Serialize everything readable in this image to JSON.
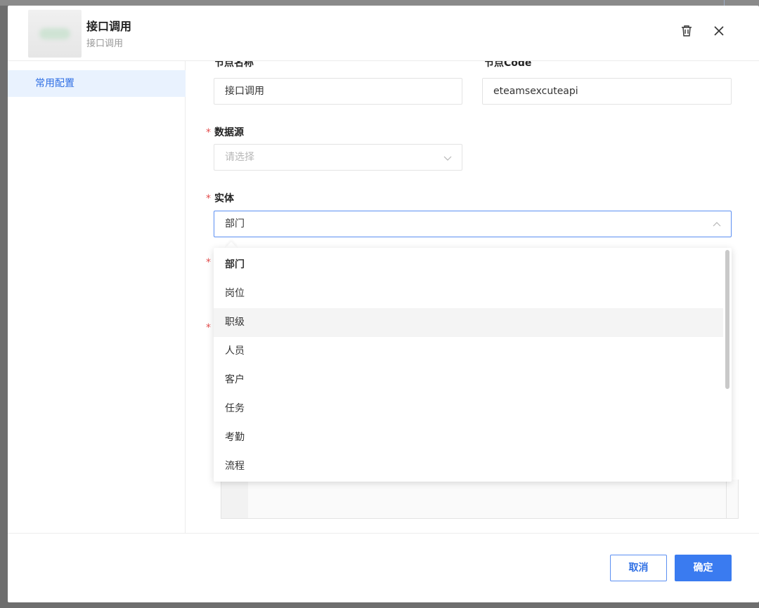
{
  "header": {
    "title": "接口调用",
    "subtitle": "接口调用"
  },
  "sidebar": {
    "items": [
      {
        "label": "常用配置",
        "active": true
      }
    ]
  },
  "form": {
    "node_name": {
      "label": "节点名称",
      "value": "接口调用"
    },
    "node_code": {
      "label": "节点Code",
      "value": "eteamsexcuteapi"
    },
    "datasource": {
      "label": "数据源",
      "placeholder": "请选择",
      "required": true
    },
    "entity": {
      "label": "实体",
      "value": "部门",
      "required": true,
      "open": true
    }
  },
  "dropdown": {
    "options": [
      "部门",
      "岗位",
      "职级",
      "人员",
      "客户",
      "任务",
      "考勤",
      "流程"
    ],
    "selected": "部门",
    "hovered": "职级"
  },
  "footer": {
    "cancel_label": "取消",
    "ok_label": "确定"
  },
  "colors": {
    "accent": "#3a7bf0",
    "required": "#e34d4d",
    "sidebar_active_bg": "#e9f2fe"
  }
}
